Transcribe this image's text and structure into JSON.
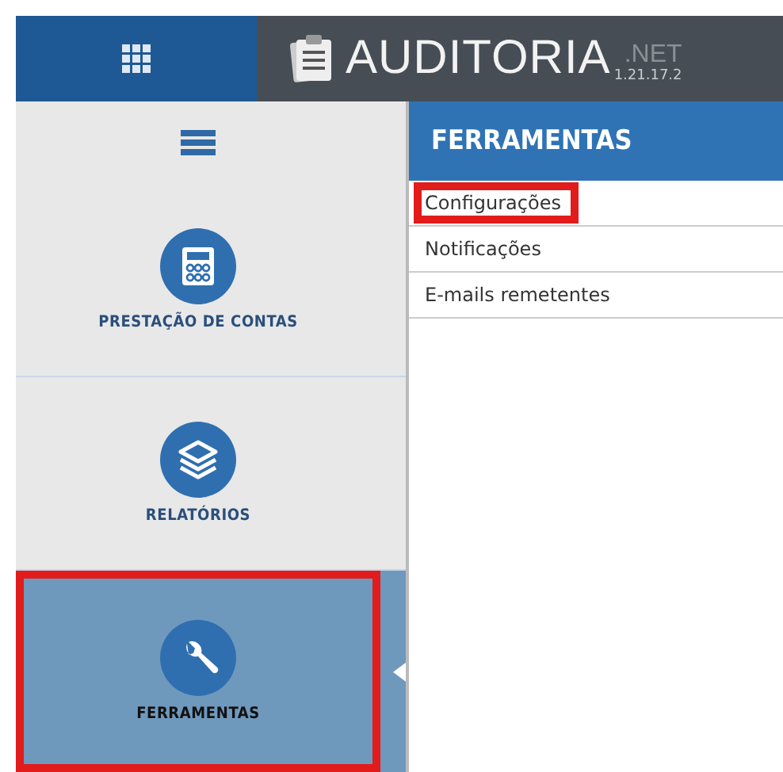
{
  "header": {
    "logo_text": "AUDITORIA",
    "logo_suffix": ".NET",
    "version": "1.21.17.2"
  },
  "sidebar": {
    "items": [
      {
        "label": "PRESTAÇÃO DE CONTAS",
        "kind": "calculator",
        "selected": false,
        "highlighted": false
      },
      {
        "label": "RELATÓRIOS",
        "kind": "layers",
        "selected": false,
        "highlighted": false
      },
      {
        "label": "FERRAMENTAS",
        "kind": "wrench",
        "selected": true,
        "highlighted": true
      }
    ]
  },
  "panel": {
    "title": "FERRAMENTAS",
    "items": [
      {
        "label": "Configurações",
        "highlighted": true
      },
      {
        "label": "Notificações",
        "highlighted": false
      },
      {
        "label": "E-mails remetentes",
        "highlighted": false
      }
    ]
  }
}
